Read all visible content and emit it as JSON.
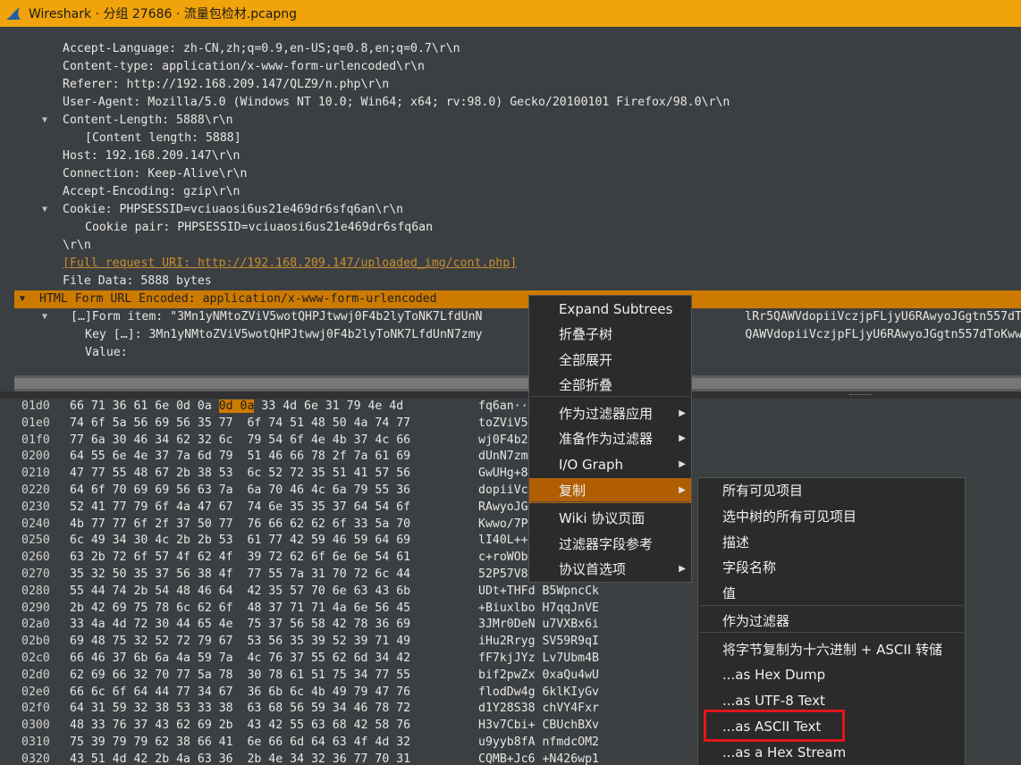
{
  "window": {
    "title": "Wireshark · 分组 27686 · 流量包检材.pcapng"
  },
  "tree": {
    "lines": [
      {
        "arrow": "",
        "text": "Accept-Language: zh-CN,zh;q=0.9,en-US;q=0.8,en;q=0.7\\r\\n"
      },
      {
        "arrow": "",
        "text": "Content-type: application/x-www-form-urlencoded\\r\\n"
      },
      {
        "arrow": "",
        "text": "Referer: http://192.168.209.147/QLZ9/n.php\\r\\n"
      },
      {
        "arrow": "",
        "text": "User-Agent: Mozilla/5.0 (Windows NT 10.0; Win64; x64; rv:98.0) Gecko/20100101 Firefox/98.0\\r\\n"
      },
      {
        "arrow": "▼",
        "text": "Content-Length: 5888\\r\\n"
      },
      {
        "arrow": "",
        "text": "[Content length: 5888]"
      },
      {
        "arrow": "",
        "text": "Host: 192.168.209.147\\r\\n"
      },
      {
        "arrow": "",
        "text": "Connection: Keep-Alive\\r\\n"
      },
      {
        "arrow": "",
        "text": "Accept-Encoding: gzip\\r\\n"
      },
      {
        "arrow": "▼",
        "text": "Cookie: PHPSESSID=vciuaosi6us21e469dr6sfq6an\\r\\n"
      },
      {
        "arrow": "",
        "text": "Cookie pair: PHPSESSID=vciuaosi6us21e469dr6sfq6an"
      },
      {
        "arrow": "",
        "text": "\\r\\n"
      },
      {
        "arrow": "",
        "text": "[Full request URI: http://192.168.209.147/uploaded_img/cont.php]"
      },
      {
        "arrow": "",
        "text": "File Data: 5888 bytes"
      },
      {
        "arrow": "▼",
        "text": "HTML Form URL Encoded: application/x-www-form-urlencoded"
      },
      {
        "arrow": "▼",
        "text": "[…]Form item: \"3Mn1yNMtoZViV5wotQHPJtwwj0F4b2lyToNK7LfdUnN                                     lRr5QAWVdopiiVczjpFLjyU6RAwyoJGgtn557dToK"
      },
      {
        "arrow": "",
        "text": "Key […]: 3Mn1yNMtoZViV5wotQHPJtwwj0F4b2lyToNK7LfdUnN7zmy                                     QAWVdopiiVczjpFLjyU6RAwyoJGgtn557dToKwwo/7"
      },
      {
        "arrow": "",
        "text": "Value:"
      }
    ]
  },
  "hex": {
    "rows": [
      {
        "offset": "01d0",
        "bytes": "66 71 36 61 6e 0d 0a ",
        "hl": "0d 0a",
        "bytes_after": " 33 4d 6e 31 79 4e 4d",
        "ascii": "fq6an··"
      },
      {
        "offset": "01e0",
        "bytes": "74 6f 5a 56 69 56 35 77  6f 74 51 48 50 4a 74 77",
        "ascii": "toZViV5"
      },
      {
        "offset": "01f0",
        "bytes": "77 6a 30 46 34 62 32 6c  79 54 6f 4e 4b 37 4c 66",
        "ascii": "wj0F4b2"
      },
      {
        "offset": "0200",
        "bytes": "64 55 6e 4e 37 7a 6d 79  51 46 66 78 2f 7a 61 69",
        "ascii": "dUnN7zm"
      },
      {
        "offset": "0210",
        "bytes": "47 77 55 48 67 2b 38 53  6c 52 72 35 51 41 57 56",
        "ascii": "GwUHg+8"
      },
      {
        "offset": "0220",
        "bytes": "64 6f 70 69 69 56 63 7a  6a 70 46 4c 6a 79 55 36",
        "ascii": "dopiiVc"
      },
      {
        "offset": "0230",
        "bytes": "52 41 77 79 6f 4a 47 67  74 6e 35 35 37 64 54 6f",
        "ascii": "RAwyoJG"
      },
      {
        "offset": "0240",
        "bytes": "4b 77 77 6f 2f 37 50 77  76 66 62 62 6f 33 5a 70",
        "ascii": "Kwwo/7P"
      },
      {
        "offset": "0250",
        "bytes": "6c 49 34 30 4c 2b 2b 53  61 77 42 59 46 59 64 69",
        "ascii": "lI40L++"
      },
      {
        "offset": "0260",
        "bytes": "63 2b 72 6f 57 4f 62 4f  39 72 62 6f 6e 6e 54 61",
        "ascii": "c+roWOb"
      },
      {
        "offset": "0270",
        "bytes": "35 32 50 35 37 56 38 4f  77 55 7a 31 70 72 6c 44",
        "ascii": "52P57V8"
      },
      {
        "offset": "0280",
        "bytes": "55 44 74 2b 54 48 46 64  42 35 57 70 6e 63 43 6b",
        "ascii": "UDt+THFd B5WpncCk"
      },
      {
        "offset": "0290",
        "bytes": "2b 42 69 75 78 6c 62 6f  48 37 71 71 4a 6e 56 45",
        "ascii": "+Biuxlbo H7qqJnVE"
      },
      {
        "offset": "02a0",
        "bytes": "33 4a 4d 72 30 44 65 4e  75 37 56 58 42 78 36 69",
        "ascii": "3JMr0DeN u7VXBx6i"
      },
      {
        "offset": "02b0",
        "bytes": "69 48 75 32 52 72 79 67  53 56 35 39 52 39 71 49",
        "ascii": "iHu2Rryg SV59R9qI"
      },
      {
        "offset": "02c0",
        "bytes": "66 46 37 6b 6a 4a 59 7a  4c 76 37 55 62 6d 34 42",
        "ascii": "fF7kjJYz Lv7Ubm4B"
      },
      {
        "offset": "02d0",
        "bytes": "62 69 66 32 70 77 5a 78  30 78 61 51 75 34 77 55",
        "ascii": "bif2pwZx 0xaQu4wU"
      },
      {
        "offset": "02e0",
        "bytes": "66 6c 6f 64 44 77 34 67  36 6b 6c 4b 49 79 47 76",
        "ascii": "flodDw4g 6klKIyGv"
      },
      {
        "offset": "02f0",
        "bytes": "64 31 59 32 38 53 33 38  63 68 56 59 34 46 78 72",
        "ascii": "d1Y28S38 chVY4Fxr"
      },
      {
        "offset": "0300",
        "bytes": "48 33 76 37 43 62 69 2b  43 42 55 63 68 42 58 76",
        "ascii": "H3v7Cbi+ CBUchBXv"
      },
      {
        "offset": "0310",
        "bytes": "75 39 79 79 62 38 66 41  6e 66 6d 64 63 4f 4d 32",
        "ascii": "u9yyb8fA nfmdcOM2"
      },
      {
        "offset": "0320",
        "bytes": "43 51 4d 42 2b 4a 63 36  2b 4e 34 32 36 77 70 31",
        "ascii": "CQMB+Jc6 +N426wp1"
      }
    ]
  },
  "context_menu": {
    "items": [
      {
        "label": "Expand Subtrees",
        "submenu": false
      },
      {
        "label": "折叠子树",
        "submenu": false
      },
      {
        "label": "全部展开",
        "submenu": false
      },
      {
        "label": "全部折叠",
        "submenu": false
      },
      {
        "label": "作为过滤器应用",
        "submenu": true
      },
      {
        "label": "准备作为过滤器",
        "submenu": true
      },
      {
        "label": "I/O Graph",
        "submenu": true
      },
      {
        "label": "复制",
        "submenu": true
      },
      {
        "label": "Wiki 协议页面",
        "submenu": false
      },
      {
        "label": "过滤器字段参考",
        "submenu": false
      },
      {
        "label": "协议首选项",
        "submenu": true
      }
    ]
  },
  "copy_submenu": {
    "items": [
      {
        "label": "所有可见项目"
      },
      {
        "label": "选中树的所有可见项目"
      },
      {
        "label": "描述"
      },
      {
        "label": "字段名称"
      },
      {
        "label": "值"
      },
      {
        "label": "作为过滤器"
      },
      {
        "label": "将字节复制为十六进制 + ASCII 转储"
      },
      {
        "label": "...as Hex Dump"
      },
      {
        "label": "...as UTF-8 Text"
      },
      {
        "label": "...as ASCII Text"
      },
      {
        "label": "...as a Hex Stream"
      }
    ]
  },
  "colors": {
    "title_bar": "#f0a30a",
    "selection": "#cd7a00",
    "menu_hover": "#b05e00",
    "highlight_box": "#e4161b"
  }
}
